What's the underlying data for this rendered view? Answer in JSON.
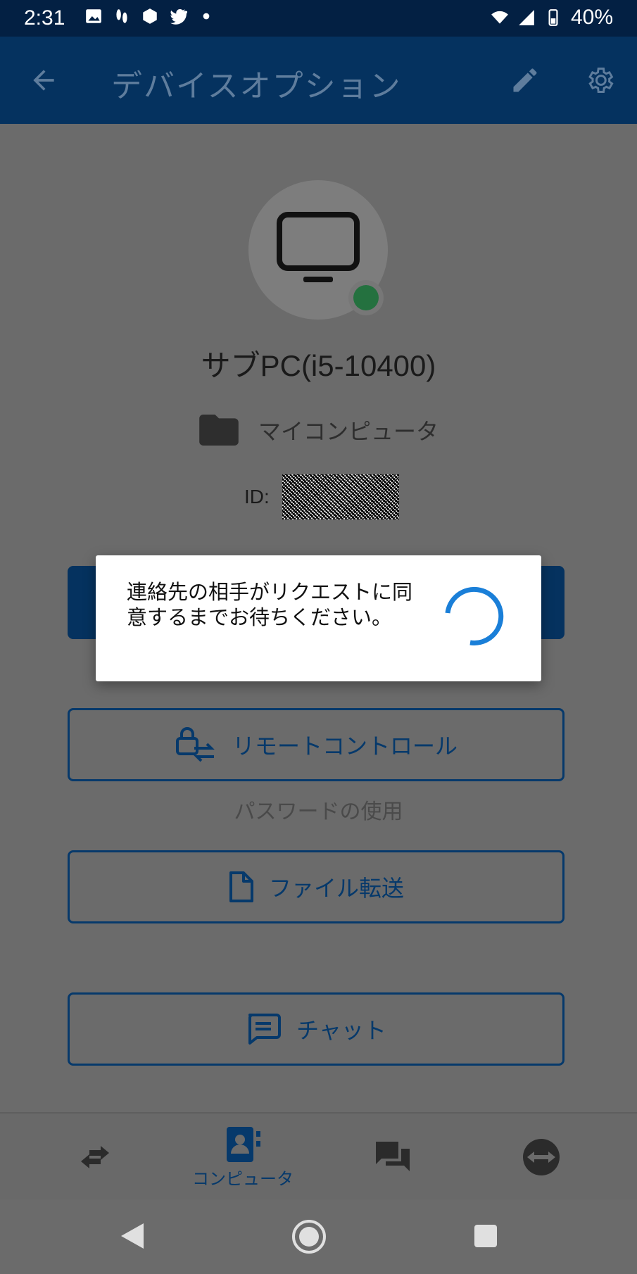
{
  "status_bar": {
    "time": "2:31",
    "battery": "40%"
  },
  "app_bar": {
    "title": "デバイスオプション"
  },
  "device": {
    "name": "サブPC(i5-10400)",
    "group": "マイコンピュータ",
    "id_label": "ID:"
  },
  "actions": {
    "remote_control": "リモートコントロール",
    "password_hint": "パスワードの使用",
    "file_transfer": "ファイル転送",
    "chat": "チャット"
  },
  "bottom_nav": {
    "computers_label": "コンピュータ"
  },
  "dialog": {
    "message": "連絡先の相手がリクエストに同意するまでお待ちください。"
  },
  "colors": {
    "primary": "#05325f",
    "accent": "#1a7fd8",
    "online": "#24713f"
  }
}
